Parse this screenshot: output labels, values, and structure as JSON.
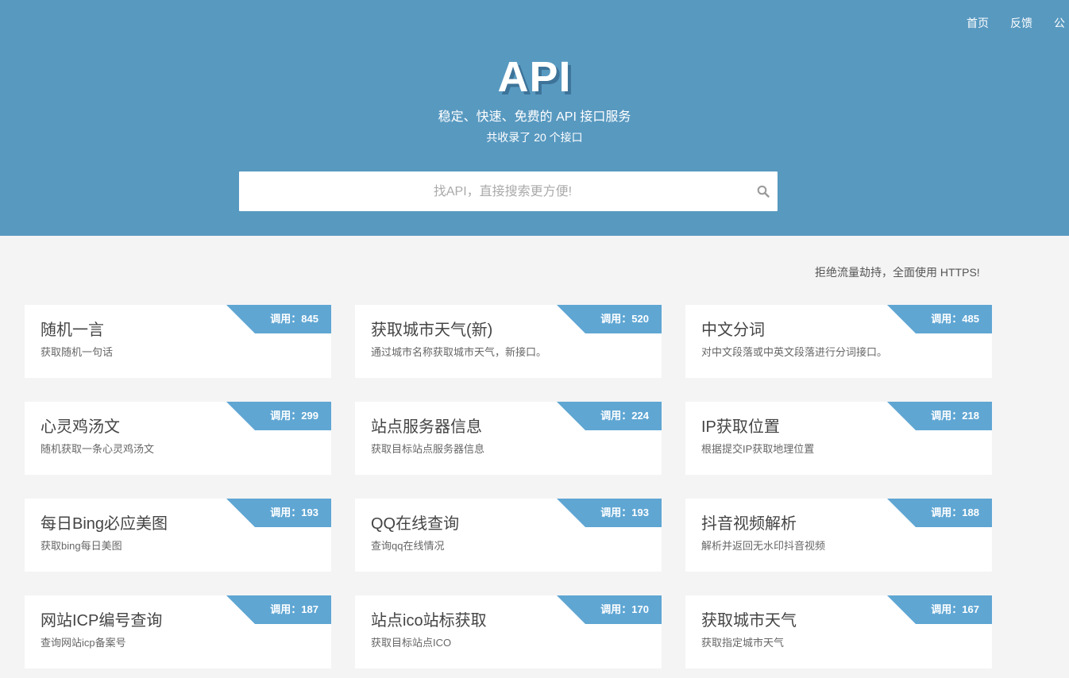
{
  "nav": {
    "items": [
      "首页",
      "反馈",
      "公"
    ]
  },
  "hero": {
    "brand": "API",
    "tagline": "稳定、快速、免费的 API 接口服务",
    "count": "共收录了 20 个接口"
  },
  "search": {
    "placeholder": "找API，直接搜索更方便!",
    "icon": "search-icon"
  },
  "notice": "拒绝流量劫持，全面使用 HTTPS!",
  "colors": {
    "hero_bg": "#5899c0",
    "ribbon": "#5fa6d3",
    "page_bg": "#f4f4f4"
  },
  "cards": [
    {
      "title": "随机一言",
      "desc": "获取随机一句话",
      "calls": "调用：845"
    },
    {
      "title": "获取城市天气(新)",
      "desc": "通过城市名称获取城市天气，新接口。",
      "calls": "调用：520"
    },
    {
      "title": "中文分词",
      "desc": "对中文段落或中英文段落进行分词接口。",
      "calls": "调用：485"
    },
    {
      "title": "心灵鸡汤文",
      "desc": "随机获取一条心灵鸡汤文",
      "calls": "调用：299"
    },
    {
      "title": "站点服务器信息",
      "desc": "获取目标站点服务器信息",
      "calls": "调用：224"
    },
    {
      "title": "IP获取位置",
      "desc": "根据提交IP获取地理位置",
      "calls": "调用：218"
    },
    {
      "title": "每日Bing必应美图",
      "desc": "获取bing每日美图",
      "calls": "调用：193"
    },
    {
      "title": "QQ在线查询",
      "desc": "查询qq在线情况",
      "calls": "调用：193"
    },
    {
      "title": "抖音视频解析",
      "desc": "解析并返回无水印抖音视频",
      "calls": "调用：188"
    },
    {
      "title": "网站ICP编号查询",
      "desc": "查询网站icp备案号",
      "calls": "调用：187"
    },
    {
      "title": "站点ico站标获取",
      "desc": "获取目标站点ICO",
      "calls": "调用：170"
    },
    {
      "title": "获取城市天气",
      "desc": "获取指定城市天气",
      "calls": "调用：167"
    }
  ]
}
